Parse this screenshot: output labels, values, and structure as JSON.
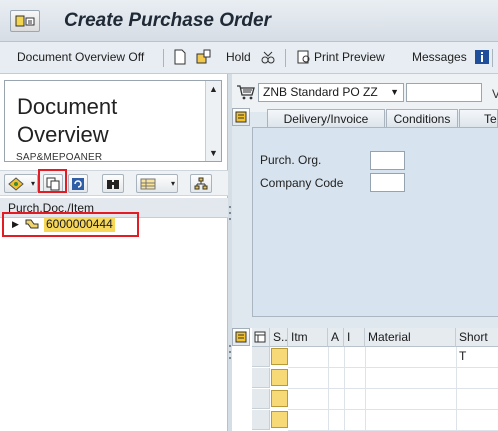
{
  "window": {
    "title": "Create Purchase Order"
  },
  "toolbar": {
    "doc_overview_label": "Document Overview Off",
    "hold_label": "Hold",
    "print_preview_label": "Print Preview",
    "messages_label": "Messages"
  },
  "left_panel": {
    "doc_overview_title": "Document Overview",
    "variant_label": "SAP&MEPOANER",
    "tree_header": "Purch.Doc./Item",
    "tree_items": [
      {
        "label": "6000000444"
      }
    ]
  },
  "header": {
    "po_type": "ZNB Standard PO ZZ",
    "po_number": "",
    "cut_label": "V"
  },
  "tabs": [
    {
      "label": "Delivery/Invoice"
    },
    {
      "label": "Conditions"
    },
    {
      "label": "Te"
    }
  ],
  "header_fields": {
    "purch_org_label": "Purch. Org.",
    "purch_org_value": "",
    "company_code_label": "Company Code",
    "company_code_value": ""
  },
  "items_grid": {
    "columns": [
      "S..",
      "Itm",
      "A",
      "I",
      "Material",
      "Short T"
    ],
    "row_count": 4
  },
  "colors": {
    "highlight_box": "#e31b23",
    "selected_item_bg": "#f6d75a",
    "tab_area_bg": "#d7e3ee"
  }
}
